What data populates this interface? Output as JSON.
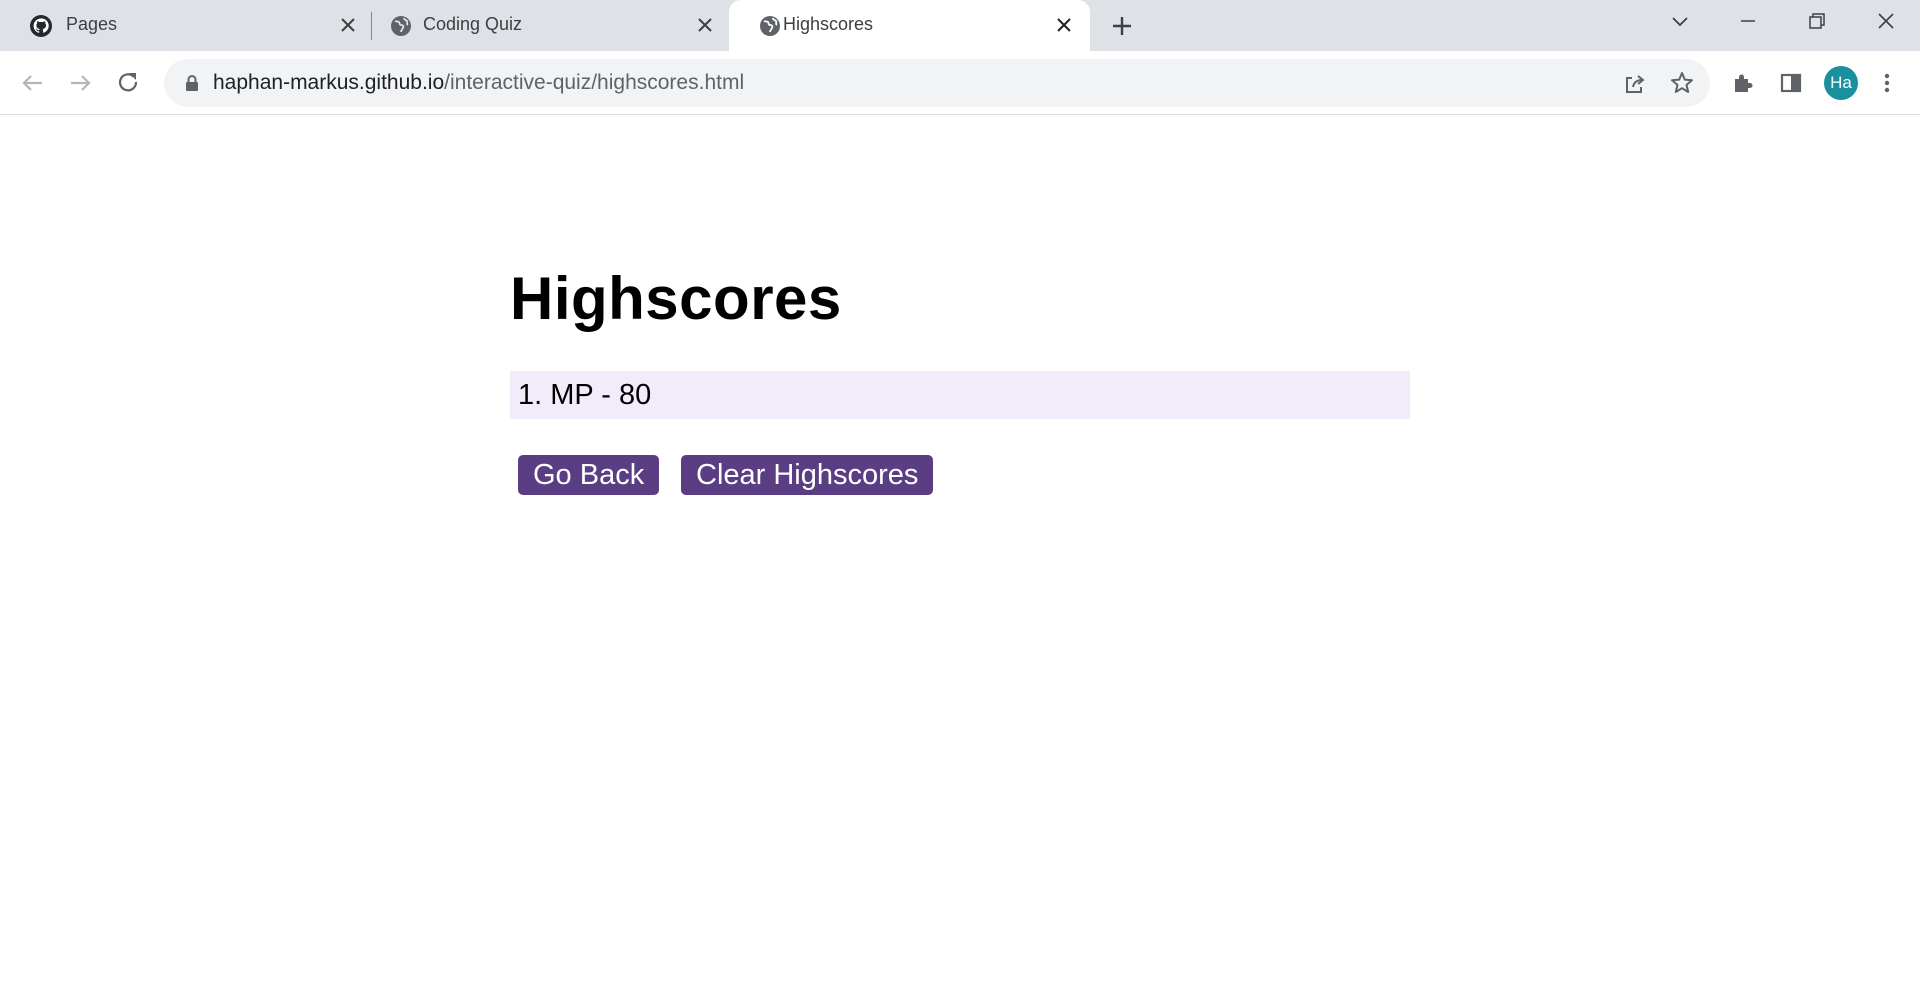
{
  "browser": {
    "tabs": [
      {
        "title": "Pages",
        "favicon": "github-icon",
        "active": false
      },
      {
        "title": "Coding Quiz",
        "favicon": "globe-icon",
        "active": false
      },
      {
        "title": "Highscores",
        "favicon": "globe-icon",
        "active": true
      }
    ],
    "url_host": "haphan-markus.github.io",
    "url_path": "/interactive-quiz/highscores.html",
    "profile_initials": "Ha",
    "profile_color": "#1a8f9e"
  },
  "page": {
    "heading": "Highscores",
    "scores": [
      {
        "label": "1. MP - 80"
      }
    ],
    "buttons": {
      "go_back": "Go Back",
      "clear": "Clear Highscores"
    },
    "colors": {
      "button_bg": "#5a3d82",
      "list_item_bg": "#f2ecfa"
    }
  }
}
